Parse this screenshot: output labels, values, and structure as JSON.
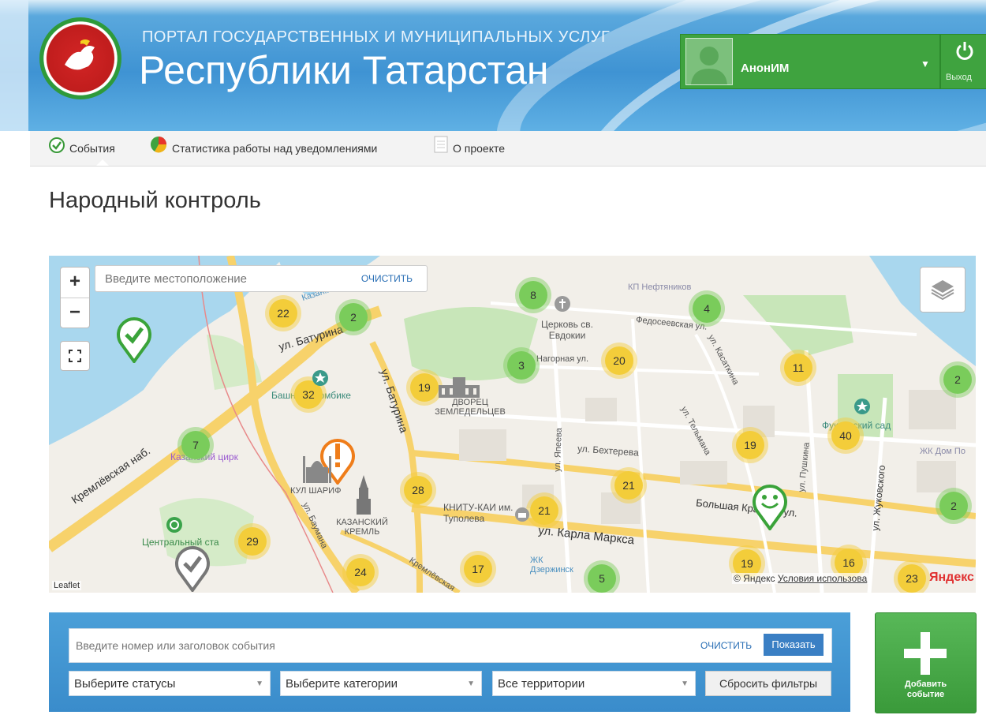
{
  "header": {
    "small_title": "ПОРТАЛ ГОСУДАРСТВЕННЫХ И МУНИЦИПАЛЬНЫХ УСЛУГ",
    "big_title": "Республики Татарстан",
    "user_name": "АнонИМ",
    "logout_label": "Выход"
  },
  "nav": {
    "items": [
      {
        "label": "События",
        "icon": "check-circle-icon"
      },
      {
        "label": "Статистика работы над уведомлениями",
        "icon": "pie-chart-icon"
      },
      {
        "label": "О проекте",
        "icon": "document-icon"
      }
    ]
  },
  "page_title": "Народный контроль",
  "map": {
    "search_placeholder": "Введите местоположение",
    "clear_label": "ОЧИСТИТЬ",
    "zoom_in": "+",
    "zoom_out": "−",
    "leaflet_label": "Leaflet",
    "attribution_prefix": "© Яндекс",
    "attribution_link": "Условия использова",
    "provider": "Яндекс",
    "clusters": [
      "22",
      "2",
      "8",
      "4",
      "3",
      "20",
      "11",
      "2",
      "19",
      "32",
      "7",
      "19",
      "40",
      "28",
      "21",
      "21",
      "2",
      "29",
      "24",
      "17",
      "5",
      "19",
      "16",
      "23"
    ],
    "labels": {
      "ul_baturina": "ул. Батурина",
      "ul_baturina_v": "ул. Батурина",
      "kremlevskaya": "Кремлёвская наб.",
      "kazanka": "Казанка",
      "church": "Церковь св. Евдокии",
      "dvorec": "ДВОРЕЦ ЗЕМЛЕДЕЛЬЦЕВ",
      "bashnya": "Башня Сююмбике",
      "circus": "Казанский цирк",
      "kul_sharif": "КУЛ ШАРИФ",
      "kreml": "КАЗАНСКИЙ КРЕМЛЬ",
      "bauman": "ул. Баумана",
      "kremlevskaya2": "Кремлёвская",
      "central": "Центральный ста",
      "knitu": "КНИТУ-КАИ им. Туполева",
      "karla_marksa": "ул. Карла Маркса",
      "bolshaya": "Большая Красная ул.",
      "bekhtereva": "ул. Бехтерева",
      "yaeeva": "ул. Япеева",
      "telmana": "ул. Тельмана",
      "pushkina": "ул. Пушкина",
      "zhukovskogo": "ул. Жуковского",
      "nagornaya": "Нагорная ул.",
      "fedoseevskaya": "Федосеевская ул.",
      "kasatkina": "ул. Касаткина",
      "kp": "КП Нефтяников",
      "fuks": "Фуксовский сад",
      "zhk_dom": "ЖК Дом По",
      "zhk_dz": "ЖК Дзержинск"
    }
  },
  "filter": {
    "search_placeholder": "Введите номер или заголовок события",
    "clear_label": "ОЧИСТИТЬ",
    "show_label": "Показать",
    "status_select": "Выберите статусы",
    "category_select": "Выберите категории",
    "territory_select": "Все территории",
    "reset_label": "Сбросить фильтры"
  },
  "add_button": {
    "line1": "Добавить",
    "line2": "событие"
  },
  "colors": {
    "header_blue": "#3f93d3",
    "green": "#3fa33f",
    "cluster_yellow": "#f3cd3a",
    "cluster_green": "#7acc5b",
    "marker_orange": "#ef7d1a"
  }
}
